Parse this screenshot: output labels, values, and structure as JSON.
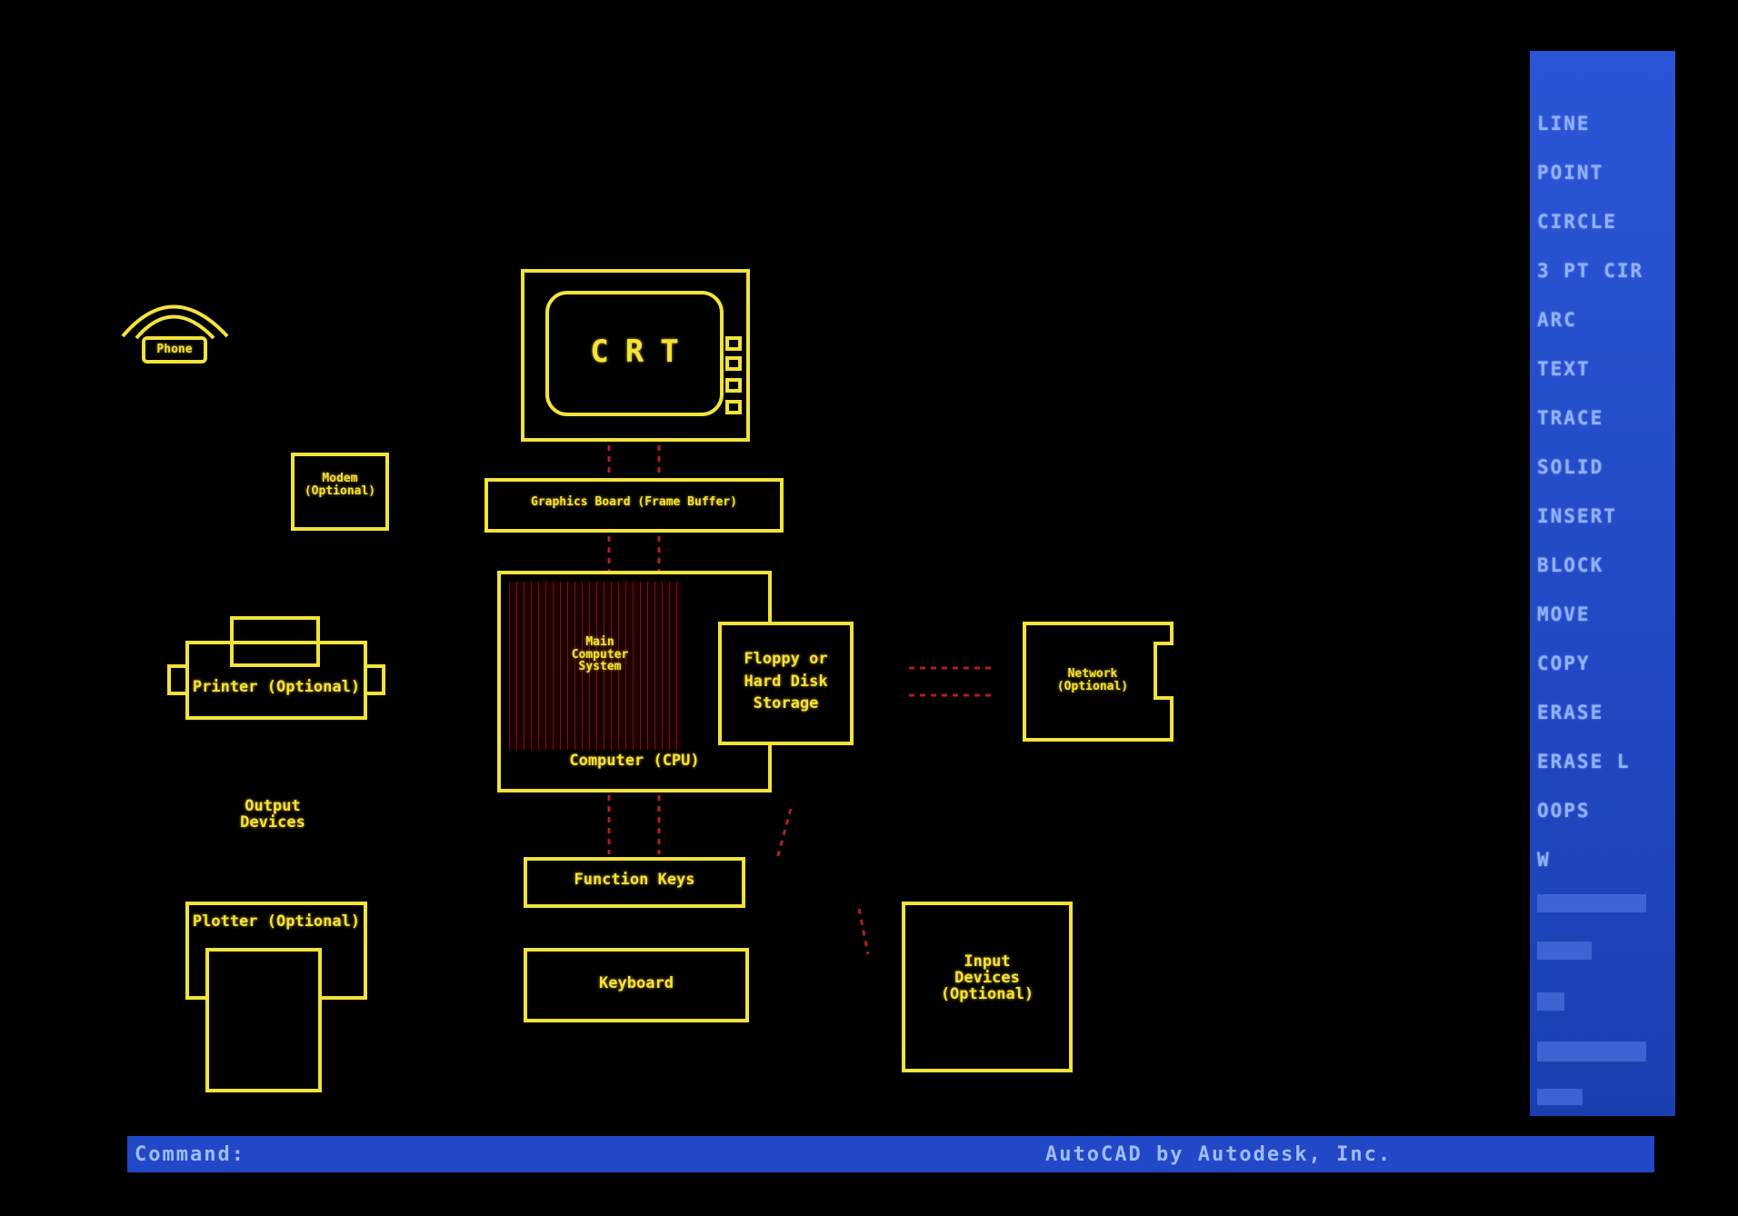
{
  "colors": {
    "background": "#000000",
    "drawing_lines": "#f2e23c",
    "accent_red": "#c0221a",
    "menu_bg": "#2148c2",
    "menu_text": "#8fb0ff",
    "command_bar_bg": "#2248c7"
  },
  "drawing": {
    "crt_label": "CRT",
    "graphics_board_label": "Graphics Board (Frame Buffer)",
    "modem_label": "Modem\n(Optional)",
    "phone_label": "Phone",
    "printer_label": "Printer (Optional)",
    "output_devices_label": "Output\nDevices",
    "plotter_label": "Plotter (Optional)",
    "cpu_inner_label": "Main\nComputer\nSystem",
    "cpu_label": "Computer (CPU)",
    "storage_label": "Floppy or\nHard Disk\nStorage",
    "network_label": "Network\n(Optional)",
    "function_keys_label": "Function Keys",
    "keyboard_label": "Keyboard",
    "input_devices_label": "Input\nDevices\n(Optional)"
  },
  "screen_menu": {
    "items": [
      "LINE",
      "POINT",
      "CIRCLE",
      "3 PT CIR",
      "ARC",
      "TEXT",
      "TRACE",
      "SOLID",
      "INSERT",
      "BLOCK",
      "MOVE",
      "COPY",
      "ERASE",
      "ERASE L",
      "OOPS",
      "W"
    ]
  },
  "command_line": {
    "prompt": "Command:",
    "credit": "AutoCAD by Autodesk, Inc."
  }
}
